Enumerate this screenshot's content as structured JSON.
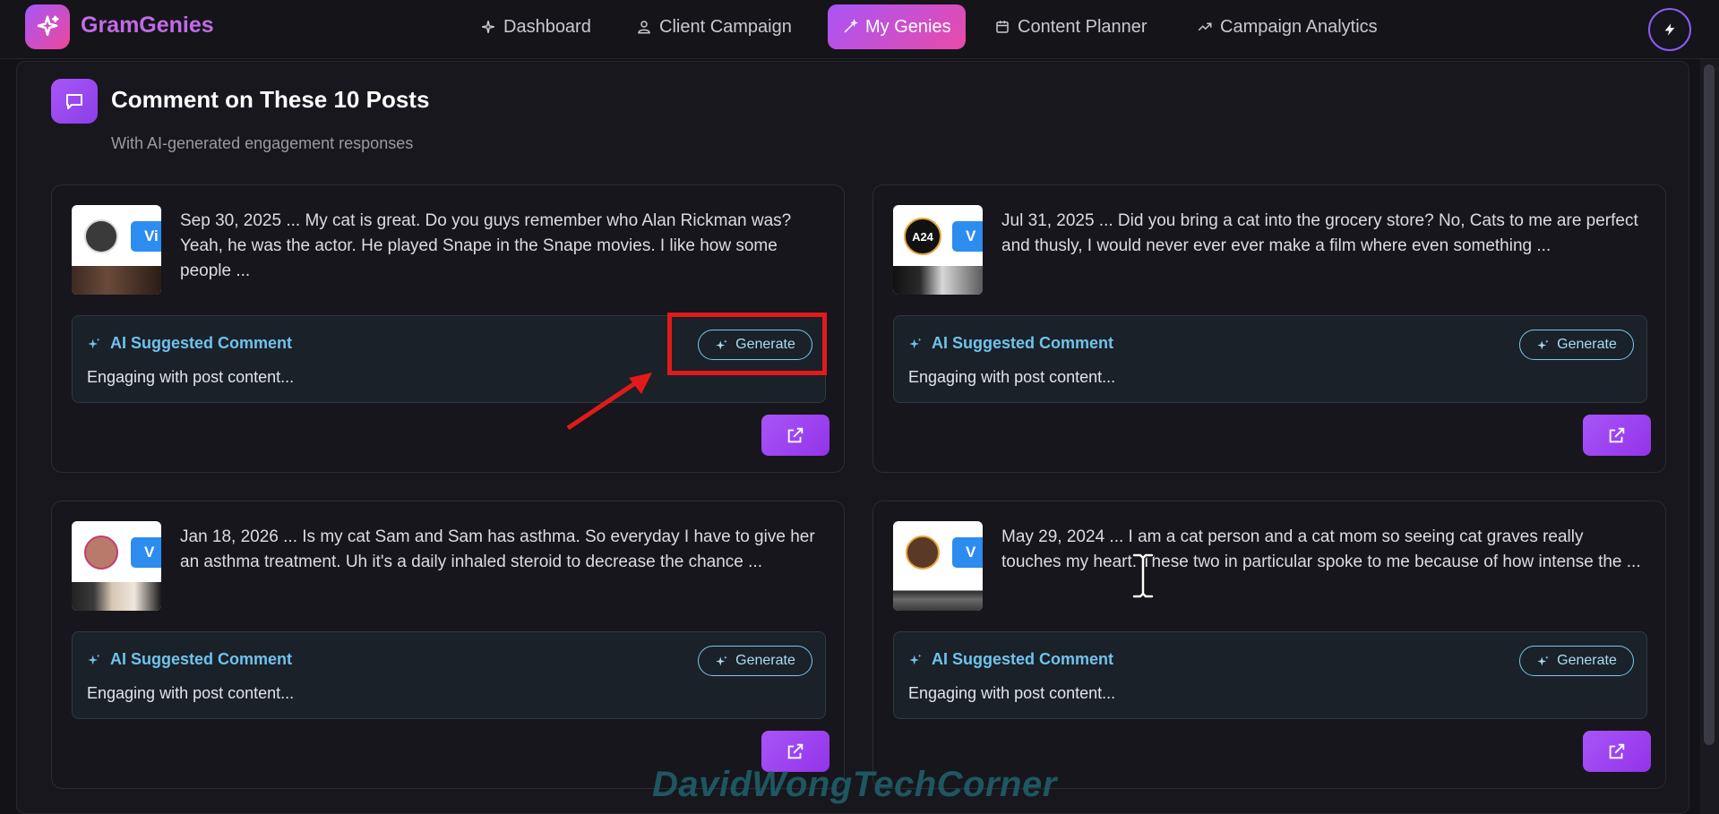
{
  "app": {
    "brand": "GramGenies"
  },
  "nav": {
    "items": [
      {
        "label": "Dashboard",
        "icon": "sparkle-icon"
      },
      {
        "label": "Client Campaign",
        "icon": "user-icon"
      },
      {
        "label": "My Genies",
        "icon": "wand-icon",
        "active": true
      },
      {
        "label": "Content Planner",
        "icon": "calendar-icon"
      },
      {
        "label": "Campaign Analytics",
        "icon": "trend-icon"
      }
    ]
  },
  "section": {
    "title": "Comment on These 10 Posts",
    "subtitle": "With AI-generated engagement responses"
  },
  "posts": [
    {
      "text": "Sep 30, 2025 ... My cat is great. Do you guys remember who Alan Rickman was? Yeah, he was the actor. He played Snape in the Snape movies. I like how some people ...",
      "thumb_badge": "Vi",
      "suggest_label": "AI Suggested Comment",
      "suggest_text": "Engaging with post content...",
      "generate_label": "Generate"
    },
    {
      "text": "Jul 31, 2025 ... Did you bring a cat into the grocery store? No, Cats to me are perfect and thusly, I would never ever ever make a film where even something ...",
      "thumb_badge": "V",
      "avatar_text": "A24",
      "suggest_label": "AI Suggested Comment",
      "suggest_text": "Engaging with post content...",
      "generate_label": "Generate"
    },
    {
      "text": "Jan 18, 2026 ... Is my cat Sam and Sam has asthma. So everyday I have to give her an asthma treatment. Uh it's a daily inhaled steroid to decrease the chance ...",
      "thumb_badge": "V",
      "suggest_label": "AI Suggested Comment",
      "suggest_text": "Engaging with post content...",
      "generate_label": "Generate"
    },
    {
      "text": "May 29, 2024 ... I am a cat person and a cat mom so seeing cat graves really touches my heart. These two in particular spoke to me because of how intense the ...",
      "thumb_badge": "V",
      "suggest_label": "AI Suggested Comment",
      "suggest_text": "Engaging with post content...",
      "generate_label": "Generate"
    }
  ],
  "watermark": "DavidWongTechCorner",
  "colors": {
    "accent": "#a855f7",
    "accent_pink": "#ec4899",
    "suggest_cyan": "#6fc3ee",
    "highlight_red": "#e11a1a"
  }
}
